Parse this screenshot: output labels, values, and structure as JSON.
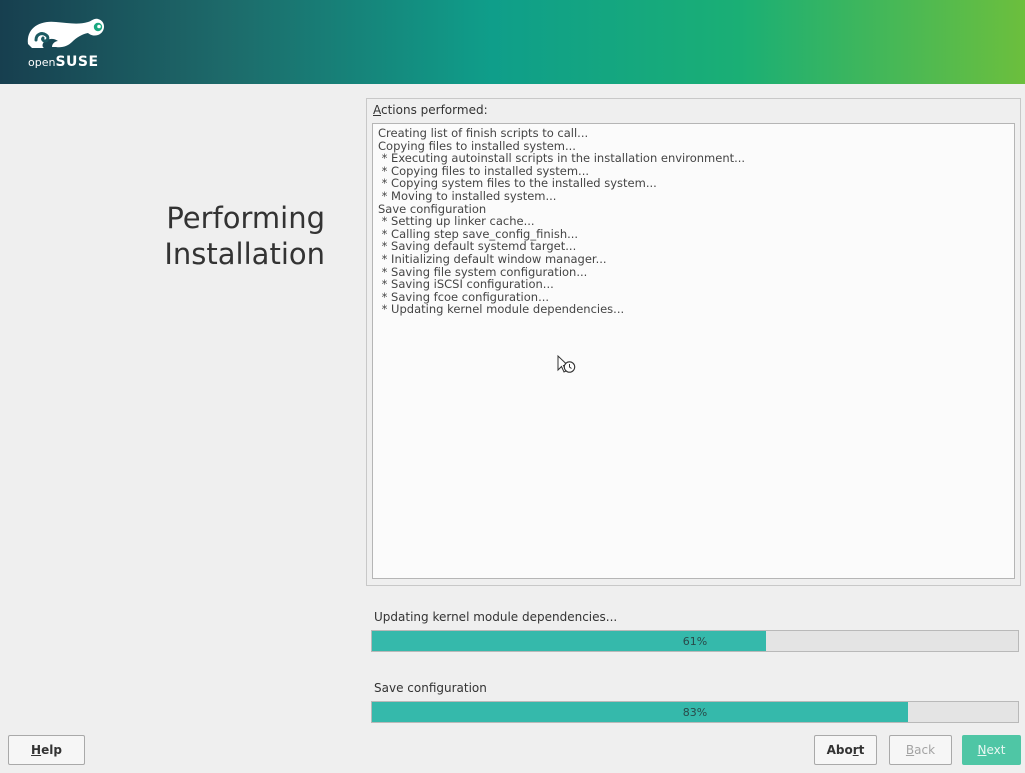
{
  "brand": {
    "logo_text_light": "open",
    "logo_text_bold": "SUSE",
    "colors": {
      "accent": "#35b9ab",
      "primary_button": "#4fc6a5"
    }
  },
  "title": {
    "line1": "Performing",
    "line2": "Installation"
  },
  "log": {
    "label_accel": "A",
    "label_rest": "ctions performed:",
    "lines": [
      "Creating list of finish scripts to call...",
      "Copying files to installed system...",
      " * Executing autoinstall scripts in the installation environment...",
      " * Copying files to installed system...",
      " * Copying system files to the installed system...",
      " * Moving to installed system...",
      "Save configuration",
      " * Setting up linker cache...",
      " * Calling step save_config_finish...",
      " * Saving default systemd target...",
      " * Initializing default window manager...",
      " * Saving file system configuration...",
      " * Saving iSCSI configuration...",
      " * Saving fcoe configuration...",
      " * Updating kernel module dependencies..."
    ]
  },
  "progress": [
    {
      "label": "Updating kernel module dependencies...",
      "percent": 61,
      "text": "61%"
    },
    {
      "label": "Save configuration",
      "percent": 83,
      "text": "83%"
    }
  ],
  "buttons": {
    "help": {
      "accel": "H",
      "rest": "elp"
    },
    "abort": {
      "before": "Abo",
      "accel": "r",
      "after": "t"
    },
    "back": {
      "accel": "B",
      "rest": "ack"
    },
    "next": {
      "accel": "N",
      "rest": "ext"
    }
  },
  "icons": {
    "logo": "opensuse-chameleon-icon",
    "cursor": "busy-cursor-icon"
  }
}
